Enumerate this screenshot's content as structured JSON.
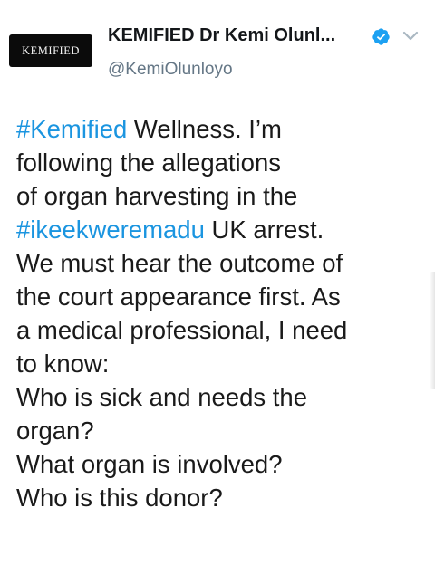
{
  "author": {
    "avatar_text": "KEMIFIED",
    "display_name": "KEMIFIED⁣ Dr Kemi Olunl...",
    "handle": "@KemiOlunloyo",
    "verified_icon": "verified-badge-icon",
    "menu_icon": "chevron-down-icon"
  },
  "tweet": {
    "lines": [
      {
        "tag": "#Kemified",
        "text": " Wellness. I’m"
      },
      {
        "text": "following the allegations"
      },
      {
        "text": "of organ harvesting in the"
      },
      {
        "tag": "#ikeekweremadu",
        "text": " UK arrest."
      },
      {
        "text": "We must hear the outcome of"
      },
      {
        "text": "the court appearance first. As"
      },
      {
        "text": "a medical professional, I need"
      },
      {
        "text": "to know:"
      },
      {
        "text": "Who is sick and needs the"
      },
      {
        "text": "organ?"
      },
      {
        "text": "What organ is involved?"
      },
      {
        "text": "Who is this donor?"
      }
    ]
  },
  "colors": {
    "link": "#1b95e0",
    "verified": "#1da1f2",
    "handle": "#657786",
    "text": "#1a1a1a"
  }
}
